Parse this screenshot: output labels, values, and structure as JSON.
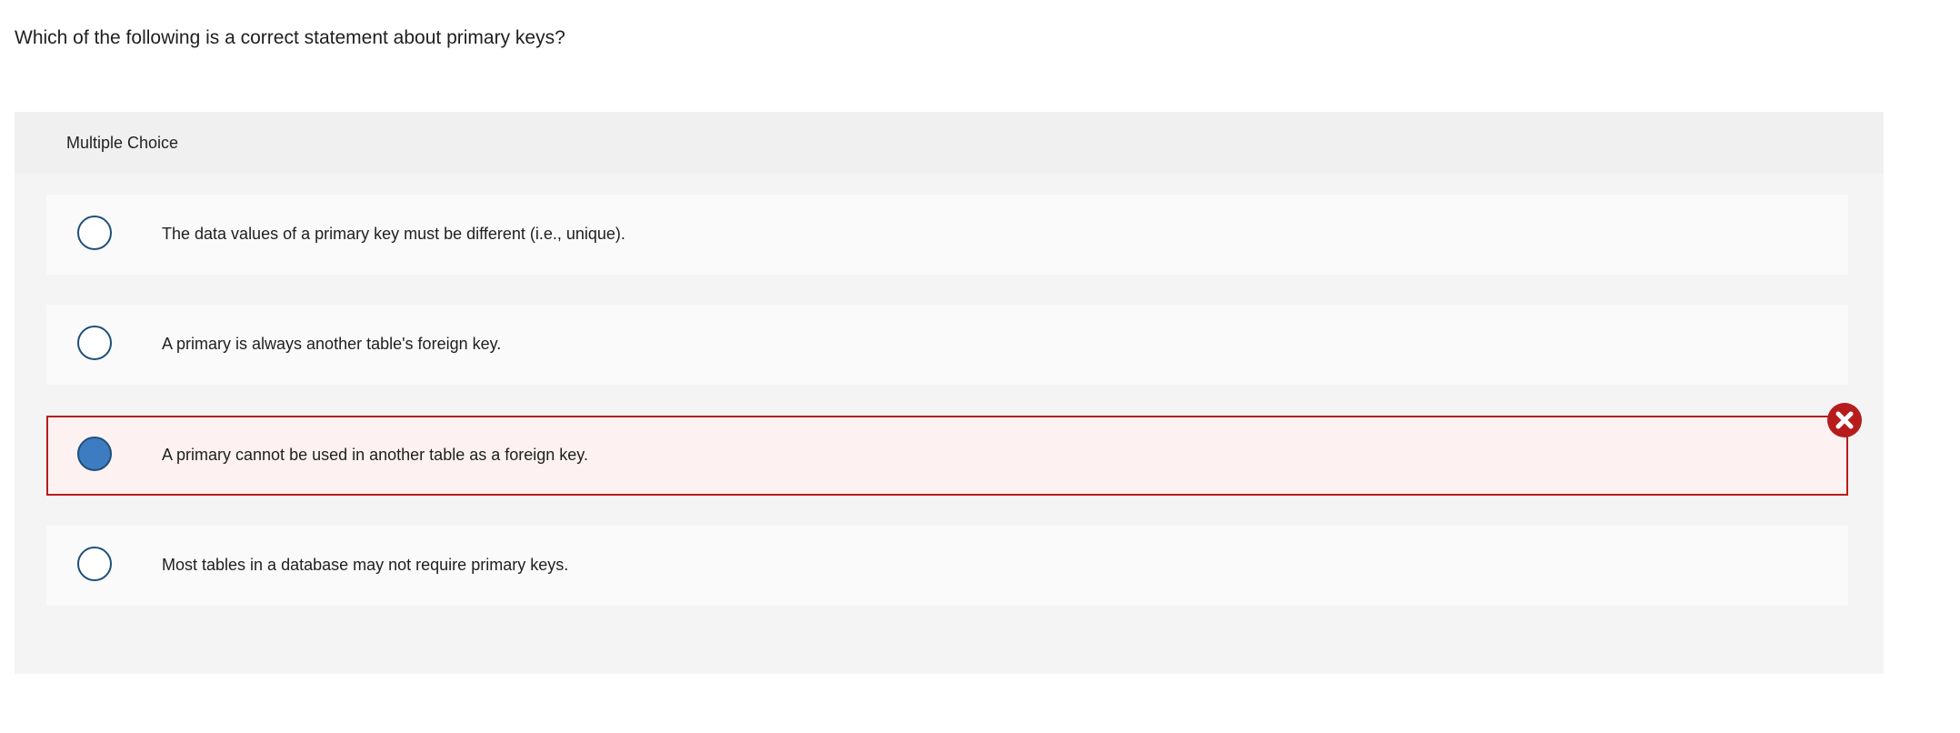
{
  "question": {
    "text": "Which of the following is a correct statement about primary keys?"
  },
  "panel": {
    "header_label": "Multiple Choice",
    "choices": [
      {
        "label": "The data values of a primary key must be different (i.e., unique).",
        "selected": false,
        "status": ""
      },
      {
        "label": "A primary is always another table's foreign key.",
        "selected": false,
        "status": ""
      },
      {
        "label": "A primary cannot be used in another table as a foreign key.",
        "selected": true,
        "status": "incorrect"
      },
      {
        "label": "Most tables in a database may not require primary keys.",
        "selected": false,
        "status": ""
      }
    ]
  },
  "icons": {
    "incorrect_badge": "close-icon"
  },
  "colors": {
    "radio_border": "#1f4f7a",
    "radio_selected_fill": "#3d7cc0",
    "incorrect_border": "#b71c1c",
    "incorrect_background": "#fdf1f1",
    "incorrect_badge": "#b71c1c"
  }
}
